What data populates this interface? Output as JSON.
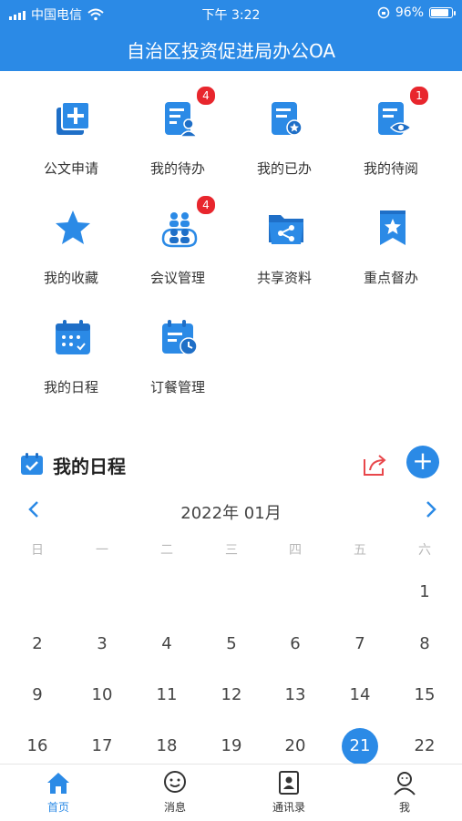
{
  "status": {
    "carrier": "中国电信",
    "time": "下午 3:22",
    "battery": "96%",
    "battery_level": 0.96
  },
  "header": {
    "title": "自治区投资促进局办公OA"
  },
  "apps": [
    {
      "label": "公文申请",
      "icon": "document-add-icon",
      "badge": ""
    },
    {
      "label": "我的待办",
      "icon": "todo-user-icon",
      "badge": "4"
    },
    {
      "label": "我的已办",
      "icon": "done-star-icon",
      "badge": ""
    },
    {
      "label": "我的待阅",
      "icon": "to-read-eye-icon",
      "badge": "1"
    },
    {
      "label": "我的收藏",
      "icon": "star-icon",
      "badge": ""
    },
    {
      "label": "会议管理",
      "icon": "meeting-people-icon",
      "badge": "4"
    },
    {
      "label": "共享资料",
      "icon": "shared-folder-icon",
      "badge": ""
    },
    {
      "label": "重点督办",
      "icon": "bookmark-star-icon",
      "badge": ""
    },
    {
      "label": "我的日程",
      "icon": "calendar-icon",
      "badge": ""
    },
    {
      "label": "订餐管理",
      "icon": "calendar-clock-icon",
      "badge": ""
    }
  ],
  "schedule": {
    "title": "我的日程",
    "month": "2022年 01月",
    "weekdays": [
      "日",
      "一",
      "二",
      "三",
      "四",
      "五",
      "六"
    ],
    "first_weekday_index": 6,
    "visible_days": [
      "1",
      "2",
      "3",
      "4",
      "5",
      "6",
      "7",
      "8",
      "9",
      "10",
      "11",
      "12",
      "13",
      "14",
      "15",
      "16",
      "17",
      "18",
      "19",
      "20",
      "21",
      "22"
    ],
    "selected_day": "21"
  },
  "tabs": [
    {
      "label": "首页",
      "icon": "home-icon",
      "active": true
    },
    {
      "label": "消息",
      "icon": "message-icon",
      "active": false
    },
    {
      "label": "通讯录",
      "icon": "contacts-icon",
      "active": false
    },
    {
      "label": "我",
      "icon": "profile-icon",
      "active": false
    }
  ],
  "colors": {
    "primary": "#2b8ae6",
    "badge": "#e8262d",
    "share": "#e8474b"
  }
}
